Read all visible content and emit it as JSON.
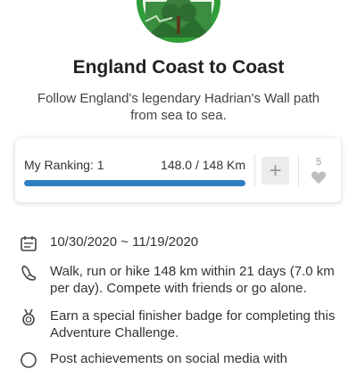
{
  "challenge": {
    "title": "England Coast to Coast",
    "description": "Follow England's legendary Hadrian's Wall path from sea to sea."
  },
  "ranking": {
    "label": "My Ranking: 1",
    "distance": "148.0 / 148 Km",
    "progress_percent": 100,
    "add_label": "+",
    "likes": "5"
  },
  "details": [
    {
      "icon": "calendar-icon",
      "text": "10/30/2020 ~ 11/19/2020"
    },
    {
      "icon": "footprint-icon",
      "text": "Walk, run or hike 148 km within 21 days (7.0 km per day). Compete with friends or go alone."
    },
    {
      "icon": "medal-icon",
      "text": "Earn a special finisher badge for completing this Adventure Challenge."
    },
    {
      "icon": "share-icon",
      "text": "Post achievements on social media with"
    }
  ],
  "colors": {
    "accent": "#2d7fc1",
    "badge_green": "#2f9e3a"
  }
}
